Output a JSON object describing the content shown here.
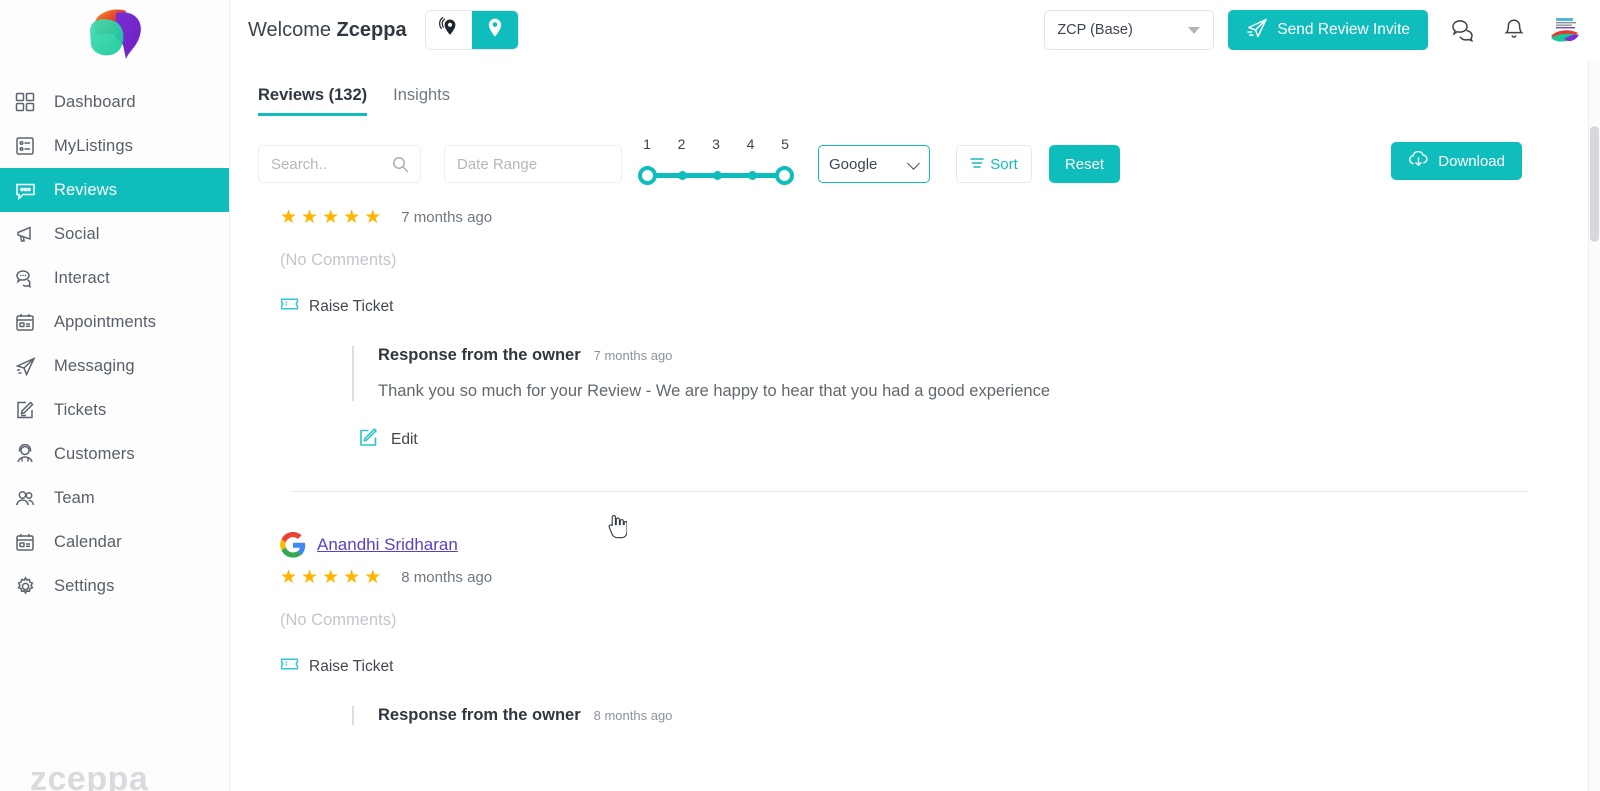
{
  "brand": {
    "name": "zceppa",
    "accent": "#0fbdbd",
    "star_color": "#ffb400",
    "link_color": "#5b3fc4"
  },
  "sidebar": {
    "logo_name": "zceppa-logo",
    "watermark": "zceppa",
    "items": [
      {
        "label": "Dashboard",
        "icon": "grid-icon",
        "active": false
      },
      {
        "label": "MyListings",
        "icon": "list-card-icon",
        "active": false
      },
      {
        "label": "Reviews",
        "icon": "chat-box-icon",
        "active": true
      },
      {
        "label": "Social",
        "icon": "megaphone-icon",
        "active": false
      },
      {
        "label": "Interact",
        "icon": "speech-bubbles-icon",
        "active": false
      },
      {
        "label": "Appointments",
        "icon": "calendar-icon",
        "active": false
      },
      {
        "label": "Messaging",
        "icon": "paper-plane-icon",
        "active": false
      },
      {
        "label": "Tickets",
        "icon": "edit-note-icon",
        "active": false
      },
      {
        "label": "Customers",
        "icon": "person-headset-icon",
        "active": false
      },
      {
        "label": "Team",
        "icon": "people-icon",
        "active": false
      },
      {
        "label": "Calendar",
        "icon": "calendar-icon",
        "active": false
      },
      {
        "label": "Settings",
        "icon": "gear-icon",
        "active": false
      }
    ]
  },
  "topbar": {
    "welcome_prefix": "Welcome ",
    "welcome_name": "Zceppa",
    "location_toggle": [
      {
        "icon": "multi-location-pin-icon",
        "selected": false
      },
      {
        "icon": "single-location-pin-icon",
        "selected": true
      }
    ],
    "account_select": {
      "value": "ZCP (Base)",
      "icon": "caret-down-icon"
    },
    "send_invite_button": {
      "label": "Send Review Invite",
      "icon": "paper-plane-icon"
    },
    "icons": [
      {
        "name": "chat-icon"
      },
      {
        "name": "notification-bell-icon"
      },
      {
        "name": "user-avatar"
      }
    ]
  },
  "tabs": [
    {
      "label": "Reviews (132)",
      "active": true
    },
    {
      "label": "Insights",
      "active": false
    }
  ],
  "filters": {
    "search": {
      "placeholder": "Search..",
      "value": "",
      "icon": "search-icon"
    },
    "date_range": {
      "placeholder": "Date Range",
      "value": ""
    },
    "rating_slider": {
      "ticks": [
        "1",
        "2",
        "3",
        "4",
        "5"
      ],
      "min": 1,
      "max": 5,
      "selected_low": 1,
      "selected_high": 5
    },
    "source_select": {
      "value": "Google",
      "icon": "chevron-down-icon"
    },
    "sort_button": {
      "label": "Sort",
      "icon": "sort-lines-icon"
    },
    "reset_button": {
      "label": "Reset"
    },
    "download_button": {
      "label": "Download",
      "icon": "cloud-download-icon"
    }
  },
  "reviews": [
    {
      "source_icon": "",
      "reviewer": "",
      "rating": 5,
      "ago": "7 months ago",
      "comment": "(No Comments)",
      "raise_ticket": {
        "label": "Raise Ticket",
        "icon": "ticket-icon"
      },
      "owner_response": {
        "title": "Response from the owner",
        "ago": "7 months ago",
        "text": "Thank you so much for your Review - We are happy to hear that you had a good experience",
        "edit": {
          "label": "Edit",
          "icon": "edit-pencil-icon"
        }
      }
    },
    {
      "source_icon": "google-logo-icon",
      "reviewer": "Anandhi Sridharan",
      "rating": 5,
      "ago": "8 months ago",
      "comment": "(No Comments)",
      "raise_ticket": {
        "label": "Raise Ticket",
        "icon": "ticket-icon"
      },
      "owner_response": {
        "title": "Response from the owner",
        "ago": "8 months ago",
        "text": "",
        "edit": {
          "label": "",
          "icon": ""
        }
      }
    }
  ],
  "star_glyph": "★"
}
